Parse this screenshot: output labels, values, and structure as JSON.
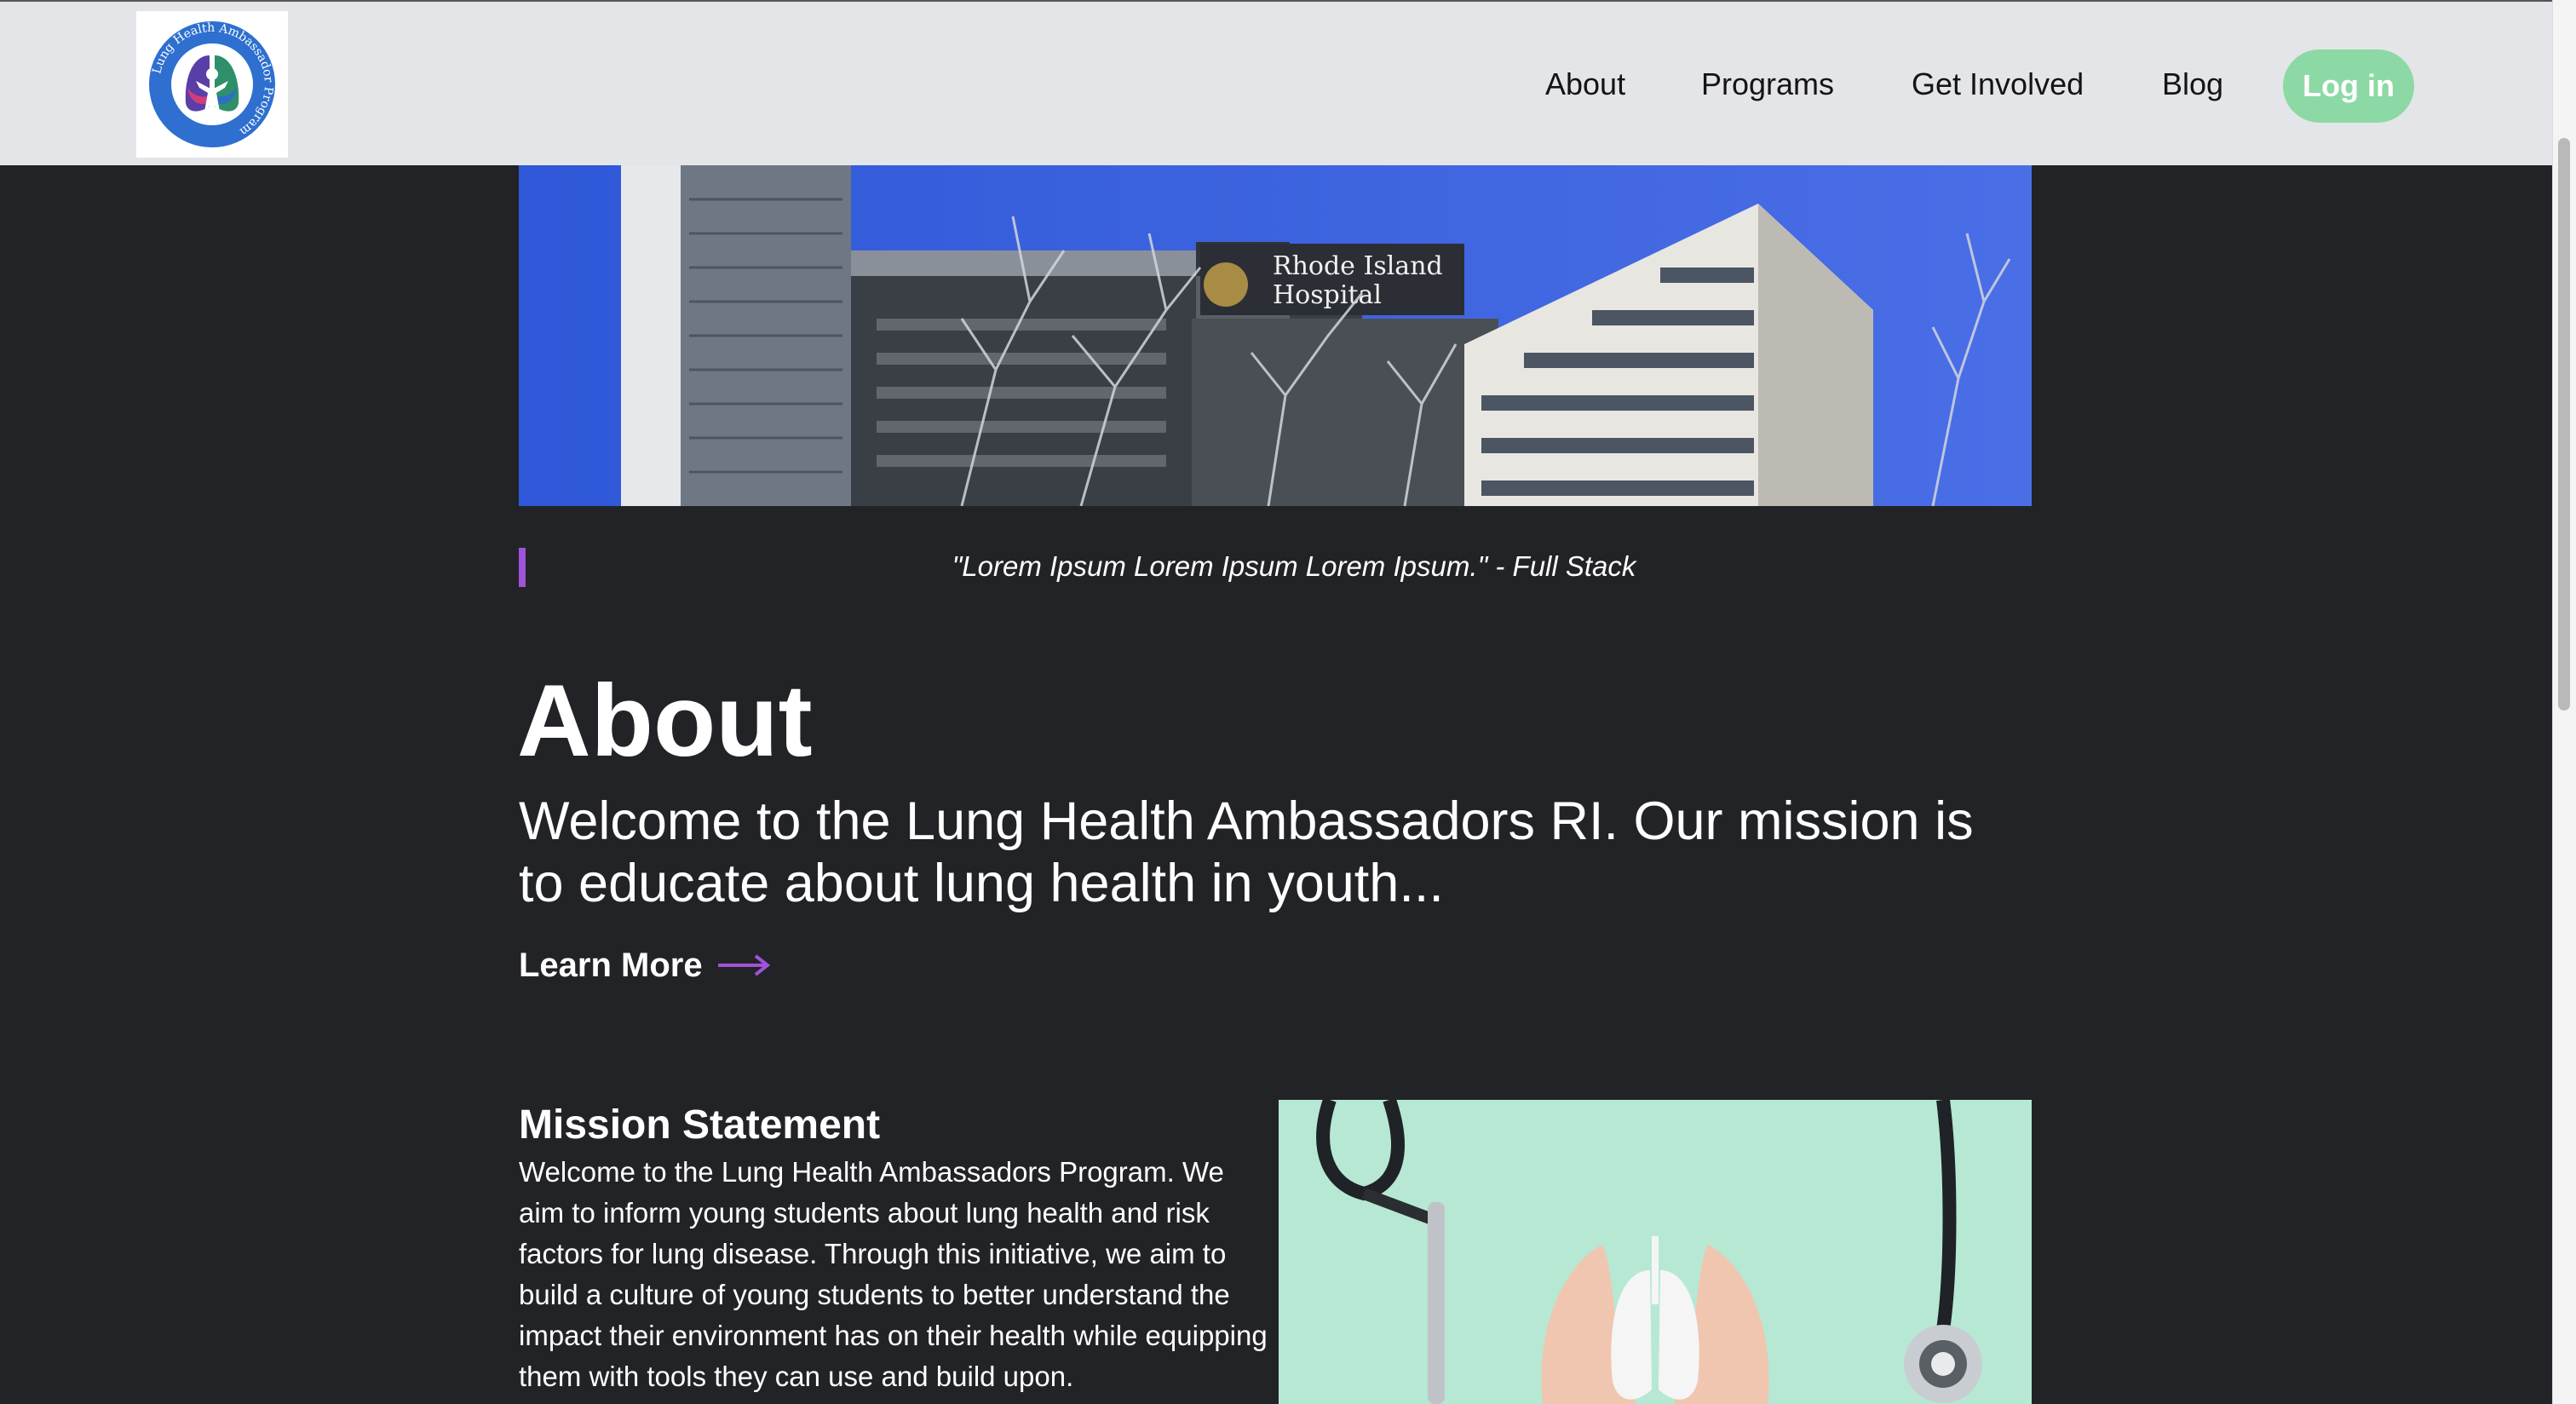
{
  "nav": {
    "logo_text": "Lung Health Ambassador Program",
    "items": [
      {
        "label": "About"
      },
      {
        "label": "Programs"
      },
      {
        "label": "Get Involved"
      },
      {
        "label": "Blog"
      }
    ],
    "login_label": "Log in"
  },
  "hero": {
    "sign_line1": "Rhode Island",
    "sign_line2": "Hospital"
  },
  "quote": "\"Lorem Ipsum Lorem Ipsum Lorem Ipsum.\" - Full Stack",
  "about": {
    "title": "About",
    "lead": "Welcome to the Lung Health Ambassadors RI. Our mission is to educate about lung health in youth...",
    "learn_more": "Learn More"
  },
  "mission": {
    "title": "Mission Statement",
    "text": "Welcome to the Lung Health Ambassadors Program. We aim to inform young students about lung health and risk factors for lung disease. Through this initiative, we aim to build a culture of young students to better understand the impact their environment has on their health while equipping them with tools they can use and build upon."
  },
  "colors": {
    "background": "#222326",
    "nav_bg": "#e4e5e9",
    "login_bg": "#8cd9a5",
    "accent_purple": "#a052d8",
    "mission_img_bg": "#b6e8d4"
  },
  "icons": [
    "lungs-logo-icon",
    "arrow-right-icon",
    "stethoscope-icon"
  ]
}
